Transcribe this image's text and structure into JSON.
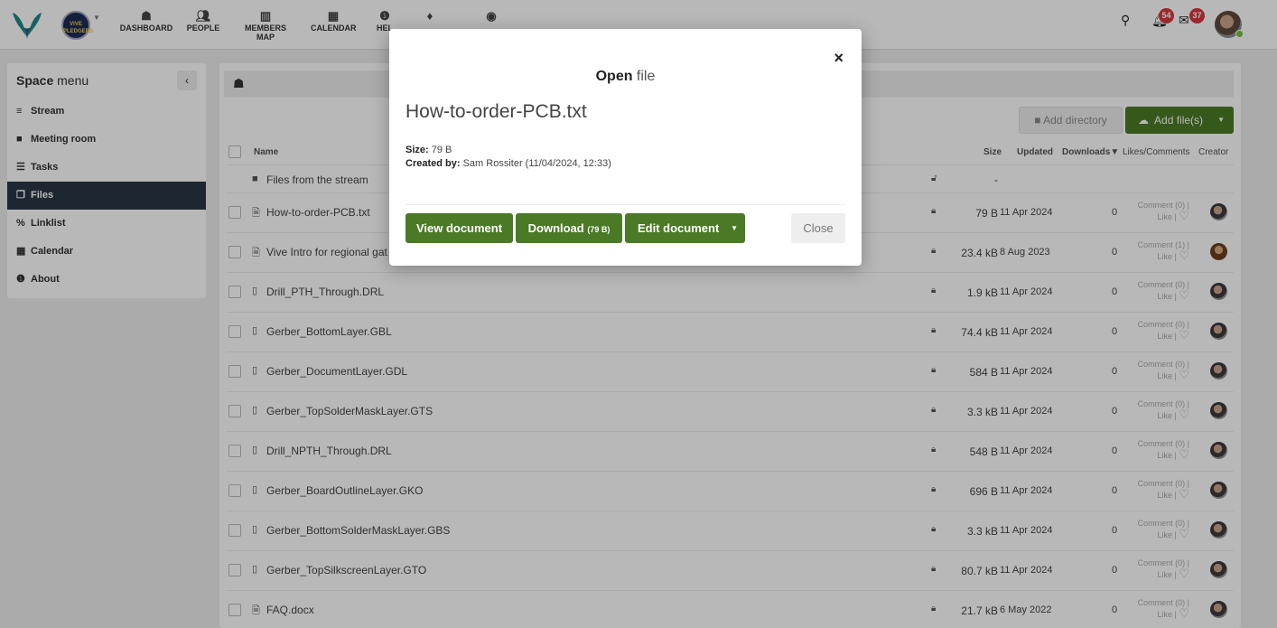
{
  "nav": {
    "items": [
      {
        "label": "DASHBOARD",
        "icon": "home-icon"
      },
      {
        "label": "PEOPLE",
        "icon": "users-icon"
      },
      {
        "label": "MEMBERS MAP",
        "icon": "map-icon"
      },
      {
        "label": "CALENDAR",
        "icon": "calendar-icon"
      },
      {
        "label": "HEL",
        "icon": "info-icon"
      }
    ],
    "notifications_count": "54",
    "messages_count": "37"
  },
  "space_avatar_text": "VIVE PLEDGERS",
  "sidebar": {
    "title_bold": "Space",
    "title_rest": " menu",
    "items": [
      {
        "label": "Stream",
        "icon": "bars-icon"
      },
      {
        "label": "Meeting room",
        "icon": "video-icon"
      },
      {
        "label": "Tasks",
        "icon": "tasks-icon"
      },
      {
        "label": "Files",
        "icon": "files-icon",
        "active": true
      },
      {
        "label": "Linklist",
        "icon": "link-icon"
      },
      {
        "label": "Calendar",
        "icon": "calendar-icon"
      },
      {
        "label": "About",
        "icon": "info-icon"
      }
    ]
  },
  "toolbar": {
    "add_directory": "Add directory",
    "add_files": "Add file(s)"
  },
  "table": {
    "headers": {
      "name": "Name",
      "size": "Size",
      "updated": "Updated",
      "downloads": "Downloads▼",
      "likes": "Likes/Comments",
      "creator": "Creator"
    },
    "folder": {
      "name": "Files from the stream",
      "size": "-"
    },
    "rows": [
      {
        "name": "How-to-order-PCB.txt",
        "size": "79 B",
        "updated": "11 Apr 2024",
        "downloads": "0",
        "comment": "Comment (0) |",
        "like": "Like |"
      },
      {
        "name": "Vive Intro for regional gat",
        "size": "23.4 kB",
        "updated": "8 Aug 2023",
        "downloads": "0",
        "comment": "Comment (1) |",
        "like": "Like |"
      },
      {
        "name": "Drill_PTH_Through.DRL",
        "size": "1.9 kB",
        "updated": "11 Apr 2024",
        "downloads": "0",
        "comment": "Comment (0) |",
        "like": "Like |"
      },
      {
        "name": "Gerber_BottomLayer.GBL",
        "size": "74.4 kB",
        "updated": "11 Apr 2024",
        "downloads": "0",
        "comment": "Comment (0) |",
        "like": "Like |"
      },
      {
        "name": "Gerber_DocumentLayer.GDL",
        "size": "584 B",
        "updated": "11 Apr 2024",
        "downloads": "0",
        "comment": "Comment (0) |",
        "like": "Like |"
      },
      {
        "name": "Gerber_TopSolderMaskLayer.GTS",
        "size": "3.3 kB",
        "updated": "11 Apr 2024",
        "downloads": "0",
        "comment": "Comment (0) |",
        "like": "Like |"
      },
      {
        "name": "Drill_NPTH_Through.DRL",
        "size": "548 B",
        "updated": "11 Apr 2024",
        "downloads": "0",
        "comment": "Comment (0) |",
        "like": "Like |"
      },
      {
        "name": "Gerber_BoardOutlineLayer.GKO",
        "size": "696 B",
        "updated": "11 Apr 2024",
        "downloads": "0",
        "comment": "Comment (0) |",
        "like": "Like |"
      },
      {
        "name": "Gerber_BottomSolderMaskLayer.GBS",
        "size": "3.3 kB",
        "updated": "11 Apr 2024",
        "downloads": "0",
        "comment": "Comment (0) |",
        "like": "Like |"
      },
      {
        "name": "Gerber_TopSilkscreenLayer.GTO",
        "size": "80.7 kB",
        "updated": "11 Apr 2024",
        "downloads": "0",
        "comment": "Comment (0) |",
        "like": "Like |"
      },
      {
        "name": "FAQ.docx",
        "size": "21.7 kB",
        "updated": "6 May 2022",
        "downloads": "0",
        "comment": "Comment (0) |",
        "like": "Like |"
      }
    ]
  },
  "modal": {
    "title_bold": "Open",
    "title_rest": " file",
    "filename": "How-to-order-PCB.txt",
    "size_label": "Size:",
    "size_value": " 79 B",
    "created_label": "Created by:",
    "created_value": " Sam Rossiter (11/04/2024, 12:33)",
    "view_button": "View document",
    "download_button": "Download",
    "download_size": "(79 B)",
    "edit_button": "Edit document",
    "close_button": "Close",
    "close_x": "×"
  },
  "colors": {
    "accent_green": "#4b7a26",
    "active_sidebar": "#2a3744",
    "badge_red": "#d9363e"
  }
}
